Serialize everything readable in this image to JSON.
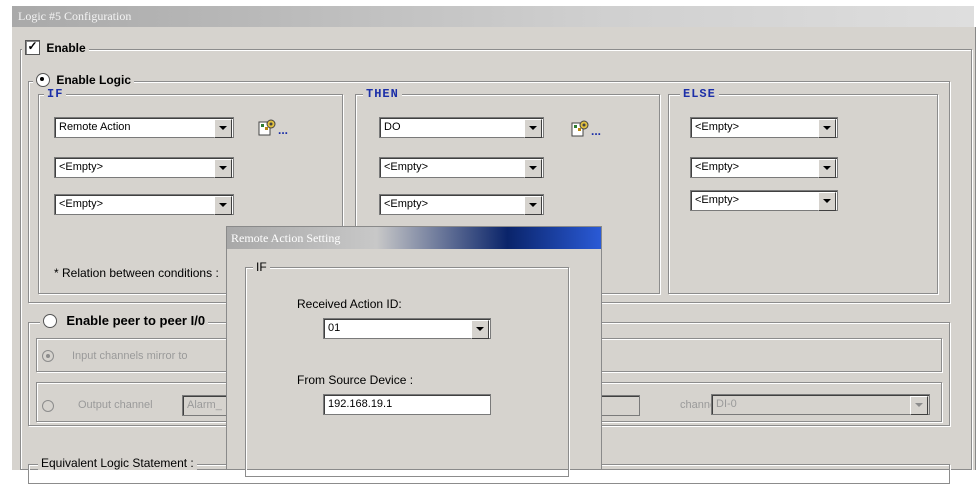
{
  "window": {
    "title": "Logic #5 Configuration"
  },
  "enable": {
    "label": "Enable",
    "checked": true,
    "check_glyph": "✓"
  },
  "logic": {
    "label": "Enable Logic",
    "if": {
      "legend": "IF",
      "rows": [
        {
          "value": "Remote Action"
        },
        {
          "value": "<Empty>"
        },
        {
          "value": "<Empty>"
        }
      ],
      "relation_label": "* Relation between conditions :"
    },
    "then": {
      "legend": "THEN",
      "rows": [
        {
          "value": "DO"
        },
        {
          "value": "<Empty>"
        },
        {
          "value": "<Empty>"
        }
      ]
    },
    "else": {
      "legend": "ELSE",
      "rows": [
        {
          "value": "<Empty>"
        },
        {
          "value": "<Empty>"
        },
        {
          "value": "<Empty>"
        }
      ]
    },
    "settings_icon": "settings-icon",
    "ellipsis": "..."
  },
  "peer": {
    "label": "Enable peer to peer I/0",
    "input_mirror_label": "Input channels mirror to",
    "output_label": "Output channel",
    "output_value": "Alarm_",
    "channel_label": "channel",
    "channel_value": "DI-0"
  },
  "equivalent": {
    "label": "Equivalent Logic Statement :"
  },
  "dialog": {
    "title": "Remote Action Setting",
    "group_legend": "IF",
    "action_id_label": "Received Action ID:",
    "action_id_value": "01",
    "source_label": "From Source Device :",
    "source_value": "192.168.19.1"
  }
}
